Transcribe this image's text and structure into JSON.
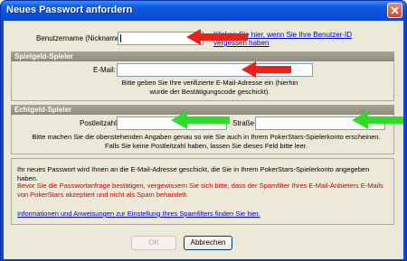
{
  "window": {
    "title": "Neues Passwort anfordern"
  },
  "username": {
    "label": "Benutzername (Nickname):",
    "value": "",
    "help_link": "Klicken Sie hier, wenn Sie Ihre Benutzer-ID vergessen haben"
  },
  "play_money": {
    "header": "Spielgeld-Spieler",
    "email_label": "E-Mail:",
    "email_value": "",
    "help": "Bitte geben Sie Ihre verifizierte E-Mail-Adresse ein (hierhin wurde der Bestätigungscode geschickt)."
  },
  "real_money": {
    "header": "Echtgeld-Spieler",
    "zip_label": "Postleitzahl:",
    "zip_value": "",
    "street_label": "Straße:",
    "street_value": "",
    "help": "Bitte machen Sie die obenstehenden Angaben genau so wie Sie auch in Ihrem PokerStars-Spielerkonto erscheinen. Falls Sie keine Postleitzahl haben, lassen Sie dieses Feld bitte leer."
  },
  "info": {
    "line1": "Ihr neues Passwort wird Ihnen an die E-Mail-Adresse geschickt, die Sie in Ihrem PokerStars-Spielerkonto angegeben haben.",
    "warning": "Bevor Sie die Passwortanfrage bestätigen, vergewissern Sie sich bitte, dass der Spamfilter Ihres E-Mail-Anbieters E-Mails von PokerStars akzeptiert und nicht als Spam behandelt.",
    "spam_link": "Informationen und Anweisungen zur Einstellung Ihres Spamfilters finden Sie hier."
  },
  "buttons": {
    "ok": "OK",
    "cancel": "Abbrechen"
  },
  "colors": {
    "arrow_red": "#e8231a",
    "arrow_green": "#2fdc2a"
  }
}
